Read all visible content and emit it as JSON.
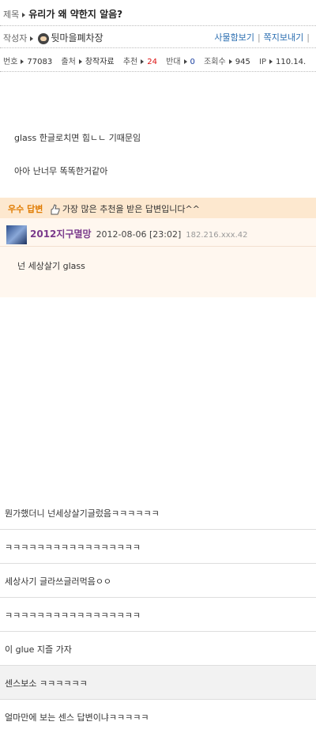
{
  "post": {
    "title_label": "제목",
    "title": "유리가 왜 약한지 알음?",
    "author_label": "작성자",
    "author": "뒷마을폐차장",
    "links": {
      "gallery": "사물함보기",
      "message": "쪽지보내기",
      "more": "|"
    },
    "meta": {
      "no_label": "번호",
      "no": "77083",
      "source_label": "출처",
      "source": "창작자료",
      "recommend_label": "추천",
      "recommend": "24",
      "oppose_label": "반대",
      "oppose": "0",
      "views_label": "조회수",
      "views": "945",
      "ip_label": "IP",
      "ip": "110.14."
    },
    "body": [
      "glass 한글로치면 힘ㄴㄴ 기때문임",
      "아아 난너무 똑똑한거같아"
    ]
  },
  "best_answer": {
    "badge": "우수 답변",
    "desc": "가장 많은 추천을 받은 답변입니다^^",
    "name": "2012지구멸망",
    "date": "2012-08-06 [23:02]",
    "ip": "182.216.xxx.42",
    "text": "넌 세상살기 glass"
  },
  "comments": [
    "뭔가했더니 넌세상살기글렀음ㅋㅋㅋㅋㅋㅋ",
    "ㅋㅋㅋㅋㅋㅋㅋㅋㅋㅋㅋㅋㅋㅋㅋㅋㅋ",
    "세상사기 글라쓰글러먹음ㅇㅇ",
    "ㅋㅋㅋㅋㅋㅋㅋㅋㅋㅋㅋㅋㅋㅋㅋㅋㅋ",
    "이 glue 지즐 가자",
    "센스보소 ㅋㅋㅋㅋㅋㅋ",
    "얼마만에 보는 센스 답변이냐ㅋㅋㅋㅋㅋ"
  ],
  "colors": {
    "best_bar": "#fde8cf",
    "best_body": "#fff7ef",
    "link": "#2a6db0",
    "best_label": "#e07b00",
    "best_name": "#7a3a8c"
  }
}
